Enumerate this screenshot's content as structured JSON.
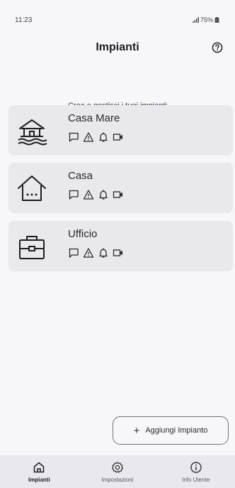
{
  "status_bar": {
    "time": "11:23",
    "battery": "75%"
  },
  "header": {
    "title": "Impianti",
    "help_icon": "help-circle-icon"
  },
  "subtitle": "Crea e gestisci i tuoi impianti",
  "impianti": [
    {
      "name": "Casa Mare",
      "icon": "beach-house-icon",
      "features": [
        "message-icon",
        "alert-triangle-icon",
        "bell-icon",
        "camera-icon"
      ]
    },
    {
      "name": "Casa",
      "icon": "home-icon",
      "features": [
        "message-icon",
        "alert-triangle-icon",
        "bell-icon",
        "camera-icon"
      ]
    },
    {
      "name": "Ufficio",
      "icon": "briefcase-icon",
      "features": [
        "message-icon",
        "alert-triangle-icon",
        "bell-icon",
        "camera-icon"
      ]
    }
  ],
  "add_button": {
    "plus": "+",
    "label": "Aggiungi Impianto"
  },
  "bottom_nav": {
    "items": [
      {
        "label": "Impianti",
        "icon": "home-icon",
        "active": true
      },
      {
        "label": "Impostazioni",
        "icon": "settings-icon",
        "active": false
      },
      {
        "label": "Info Utente",
        "icon": "info-icon",
        "active": false
      }
    ]
  },
  "colors": {
    "background": "#f7f7fa",
    "card": "#e8e8ed",
    "nav_background": "#e9e8ef",
    "text": "#1e1e22"
  }
}
